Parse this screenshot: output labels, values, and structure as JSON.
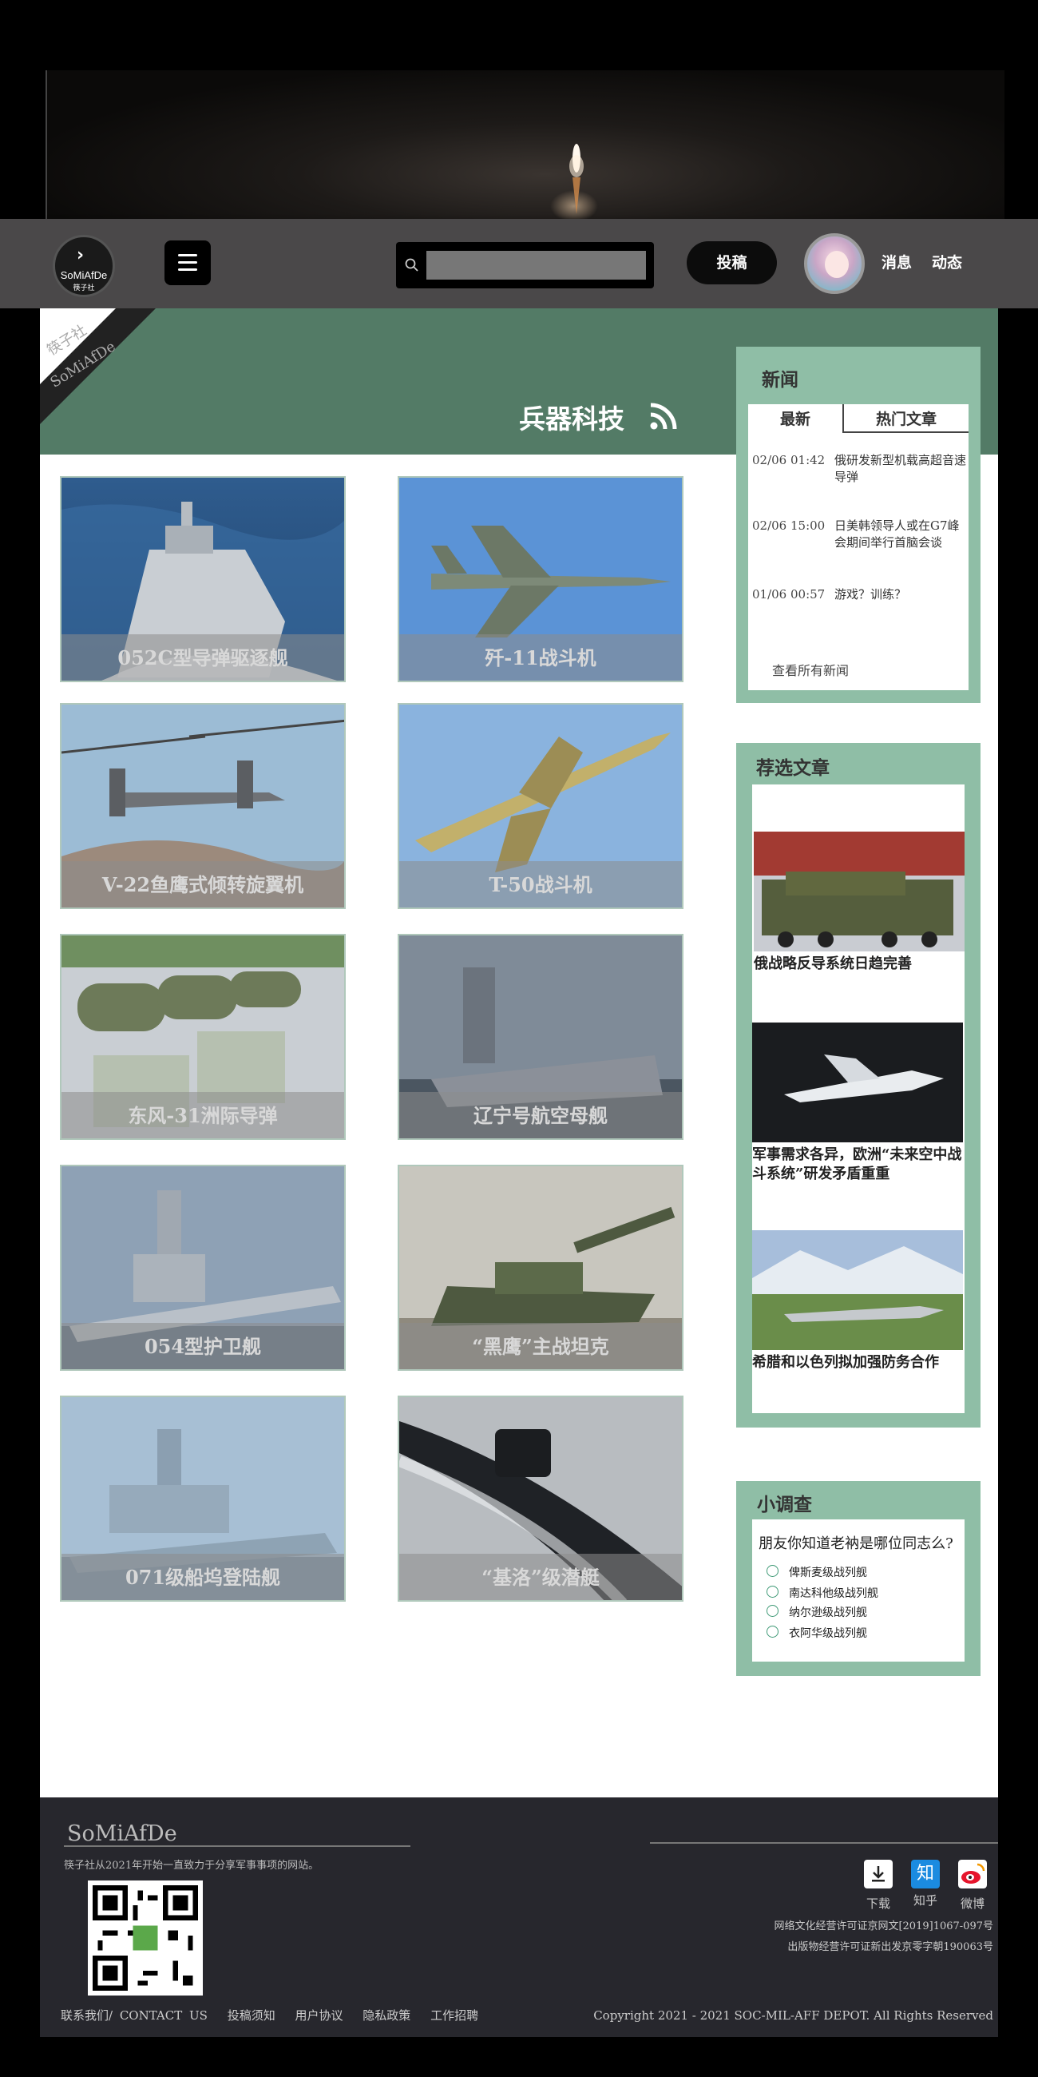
{
  "header": {
    "logo_text": "SoMiAfDe",
    "logo_sub": "筷子社",
    "search_placeholder": "",
    "submit_label": "投稿",
    "nav": [
      "消息",
      "动态"
    ]
  },
  "ribbon": {
    "line1": "筷子社",
    "line2": "SoMiAfDe"
  },
  "category": {
    "title": "兵器科技"
  },
  "grid": [
    {
      "caption": "052C型导弹驱逐舰"
    },
    {
      "caption": "歼-11战斗机"
    },
    {
      "caption": "V-22鱼鹰式倾转旋翼机"
    },
    {
      "caption": "T-50战斗机"
    },
    {
      "caption": "东风-31洲际导弹"
    },
    {
      "caption": "辽宁号航空母舰"
    },
    {
      "caption": "054型护卫舰"
    },
    {
      "caption": "“黑鹰”主战坦克"
    },
    {
      "caption": "071级船坞登陆舰"
    },
    {
      "caption": "“基洛”级潜艇"
    }
  ],
  "news": {
    "title": "新闻",
    "tabs": [
      "最新",
      "热门文章"
    ],
    "items": [
      {
        "date": "02/06 01:42",
        "title": "俄研发新型机载高超音速导弹"
      },
      {
        "date": "02/06 15:00",
        "title": "日美韩领导人或在G7峰会期间举行首脑会谈"
      },
      {
        "date": "01/06 00:57",
        "title": "游戏？训练？"
      }
    ],
    "more": "查看所有新闻"
  },
  "recommended": {
    "title": "荐选文章",
    "items": [
      {
        "title": "俄战略反导系统日趋完善"
      },
      {
        "title": "军事需求各异，欧洲“未来空中战斗系统”研发矛盾重重"
      },
      {
        "title": "希腊和以色列拟加强防务合作"
      }
    ]
  },
  "poll": {
    "title": "小调查",
    "question": "朋友你知道老衲是哪位同志么?",
    "options": [
      "俾斯麦级战列舰",
      "南达科他级战列舰",
      "纳尔逊级战列舰",
      "衣阿华级战列舰"
    ]
  },
  "footer": {
    "brand": "SoMiAfDe",
    "desc": "筷子社从2021年开始一直致力于分享军事事项的网站。",
    "links": [
      "联系我们/ CONTACT US",
      "投稿须知",
      "用户协议",
      "隐私政策",
      "工作招聘"
    ],
    "social": [
      {
        "label": "下载",
        "icon": "download-icon"
      },
      {
        "label": "知乎",
        "icon": "zhihu-icon",
        "glyph": "知"
      },
      {
        "label": "微博",
        "icon": "weibo-icon"
      }
    ],
    "license1": "网络文化经营许可证京网文[2019]1067-097号",
    "license2": "出版物经营许可证新出发京零字朝190063号",
    "copyright": "Copyright  2021 - 2021 SOC-MIL-AFF DEPOT. All Rights Reserved"
  },
  "colors": {
    "accent": "#537b66",
    "sidebar": "#8fbea6",
    "header": "#4a4849",
    "footer": "#27272d"
  }
}
